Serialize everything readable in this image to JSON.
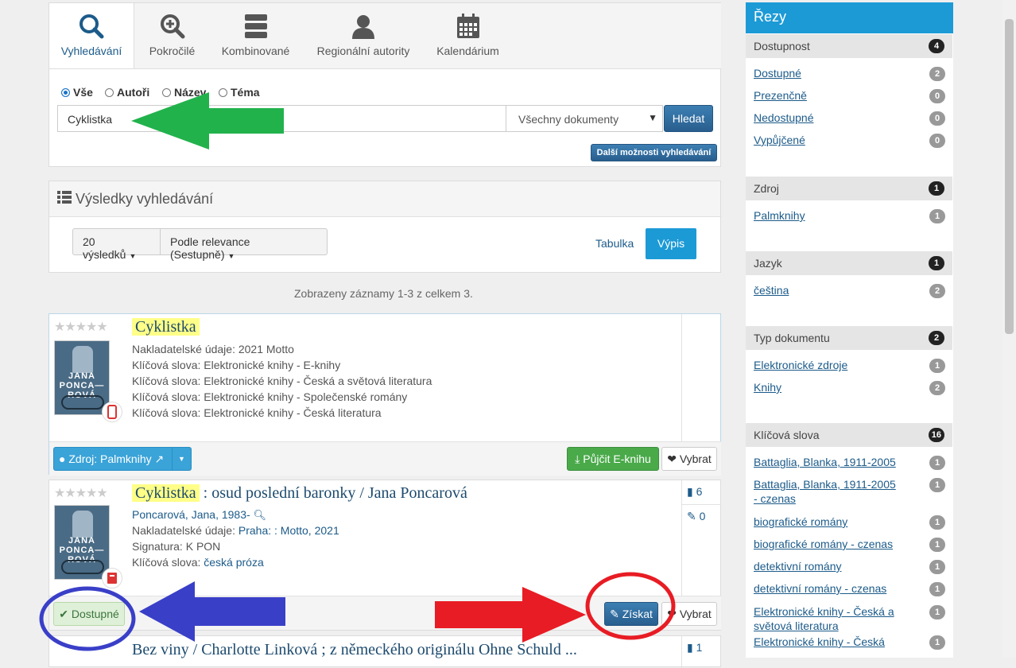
{
  "search": {
    "tabs": [
      {
        "label": "Vyhledávání",
        "icon": "search-icon"
      },
      {
        "label": "Pokročilé",
        "icon": "zoom-plus-icon"
      },
      {
        "label": "Kombinované",
        "icon": "server-icon"
      },
      {
        "label": "Regionální autority",
        "icon": "user-icon"
      },
      {
        "label": "Kalendárium",
        "icon": "calendar-icon"
      }
    ],
    "radios": [
      "Vše",
      "Autoři",
      "Název",
      "Téma"
    ],
    "query": "Cyklistka",
    "doc_type": "Všechny dokumenty",
    "submit": "Hledat",
    "more_options": "Další možnosti vyhledávání"
  },
  "results": {
    "title": "Výsledky vyhledávání",
    "per_page": "20 výsledků",
    "sort": "Podle relevance (Sestupně)",
    "view_table": "Tabulka",
    "view_list": "Výpis",
    "summary": "Zobrazeny záznamy 1-3 z celkem 3."
  },
  "records": [
    {
      "title_hl": "Cyklistka",
      "title_rest": "",
      "cover_text": "JANA PONCA—ROVÁ",
      "lines": [
        "Nakladatelské údaje: 2021 Motto",
        "Klíčová slova: Elektronické knihy - E-knihy",
        "Klíčová slova: Elektronické knihy - Česká a světová literatura",
        "Klíčová slova: Elektronické knihy - Společenské romány",
        "Klíčová slova: Elektronické knihy - Česká literatura"
      ],
      "source_btn": "Zdroj: Palmknihy",
      "borrow_btn": "Půjčit E-knihu",
      "select_btn": "Vybrat"
    },
    {
      "title_hl": "Cyklistka",
      "title_rest": ": osud poslední baronky / Jana Poncarová",
      "cover_text": "JANA PONCA—ROVÁ",
      "author": "Poncarová, Jana, 1983-",
      "pub_label": "Nakladatelské údaje:",
      "pub_value": "Praha: : Motto, 2021",
      "sig_line": "Signatura: K PON",
      "kw_label": "Klíčová slova:",
      "kw_value": "česká próza",
      "copies": "6",
      "edits": "0",
      "status_btn": "Dostupné",
      "get_btn": "Získat",
      "select_btn": "Vybrat"
    },
    {
      "title_hl": "",
      "title_rest": "Bez viny / Charlotte Linková ; z německého originálu Ohne Schuld ...",
      "copies": "1"
    }
  ],
  "facets": {
    "title": "Řezy",
    "groups": [
      {
        "name": "Dostupnost",
        "count": "4",
        "items": [
          {
            "label": "Dostupné",
            "count": "2"
          },
          {
            "label": "Prezenčně",
            "count": "0"
          },
          {
            "label": "Nedostupné",
            "count": "0"
          },
          {
            "label": "Vypůjčené",
            "count": "0"
          }
        ]
      },
      {
        "name": "Zdroj",
        "count": "1",
        "items": [
          {
            "label": "Palmknihy",
            "count": "1"
          }
        ]
      },
      {
        "name": "Jazyk",
        "count": "1",
        "items": [
          {
            "label": "čeština",
            "count": "2"
          }
        ]
      },
      {
        "name": "Typ dokumentu",
        "count": "2",
        "items": [
          {
            "label": "Elektronické zdroje",
            "count": "1"
          },
          {
            "label": "Knihy",
            "count": "2"
          }
        ]
      },
      {
        "name": "Klíčová slova",
        "count": "16",
        "items": [
          {
            "label": "Battaglia, Blanka, 1911-2005",
            "count": "1"
          },
          {
            "label": "Battaglia, Blanka, 1911-2005 - czenas",
            "count": "1"
          },
          {
            "label": "biografické romány",
            "count": "1"
          },
          {
            "label": "biografické romány - czenas",
            "count": "1"
          },
          {
            "label": "detektivní romány",
            "count": "1"
          },
          {
            "label": "detektivní romány - czenas",
            "count": "1"
          },
          {
            "label": "Elektronické knihy - Česká a světová literatura",
            "count": "1"
          },
          {
            "label": "Elektronické knihy - Česká",
            "count": "1"
          }
        ]
      }
    ]
  },
  "colors": {
    "accent": "#1c9ad6",
    "green_arrow": "#22b24c",
    "blue_arrow": "#3a3fc8",
    "red_arrow": "#e81c24"
  }
}
